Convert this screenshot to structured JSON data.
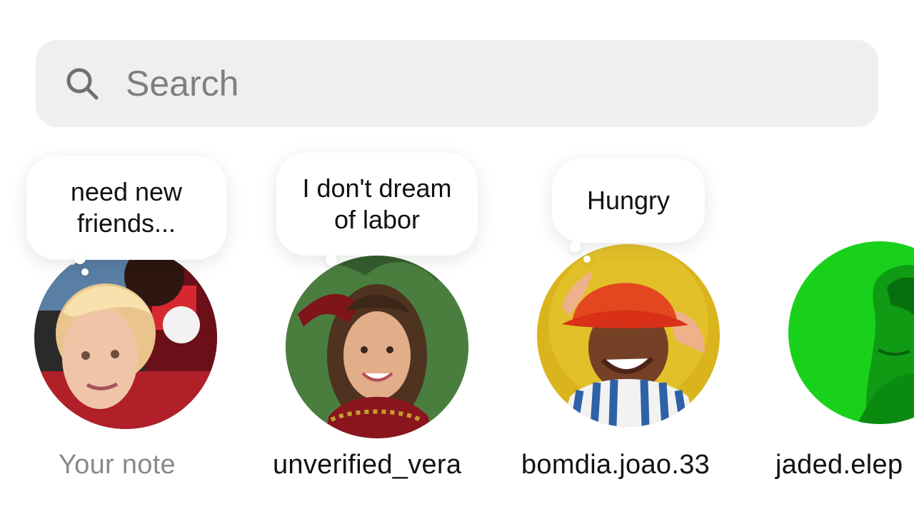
{
  "search": {
    "placeholder": "Search",
    "icon": "search-icon"
  },
  "notes": [
    {
      "note_line1": "need new",
      "note_line2": "friends...",
      "username": "Your note",
      "avatar": "avatar-your-note"
    },
    {
      "note_line1": "I don't dream",
      "note_line2": "of labor",
      "username": "unverified_vera",
      "avatar": "avatar-unverified-vera"
    },
    {
      "note_line1": "Hungry",
      "note_line2": "",
      "username": "bomdia.joao.33",
      "avatar": "avatar-bomdia-joao"
    },
    {
      "note_line1": "",
      "note_line2": "",
      "username": "jaded.elep",
      "avatar": "avatar-jaded-elep"
    }
  ],
  "colors": {
    "search_background": "#efefef",
    "placeholder_text": "#7f7f7f",
    "username_text": "#121212",
    "own_username_text": "#8a8a8a",
    "green_avatar": "#19d11a"
  }
}
